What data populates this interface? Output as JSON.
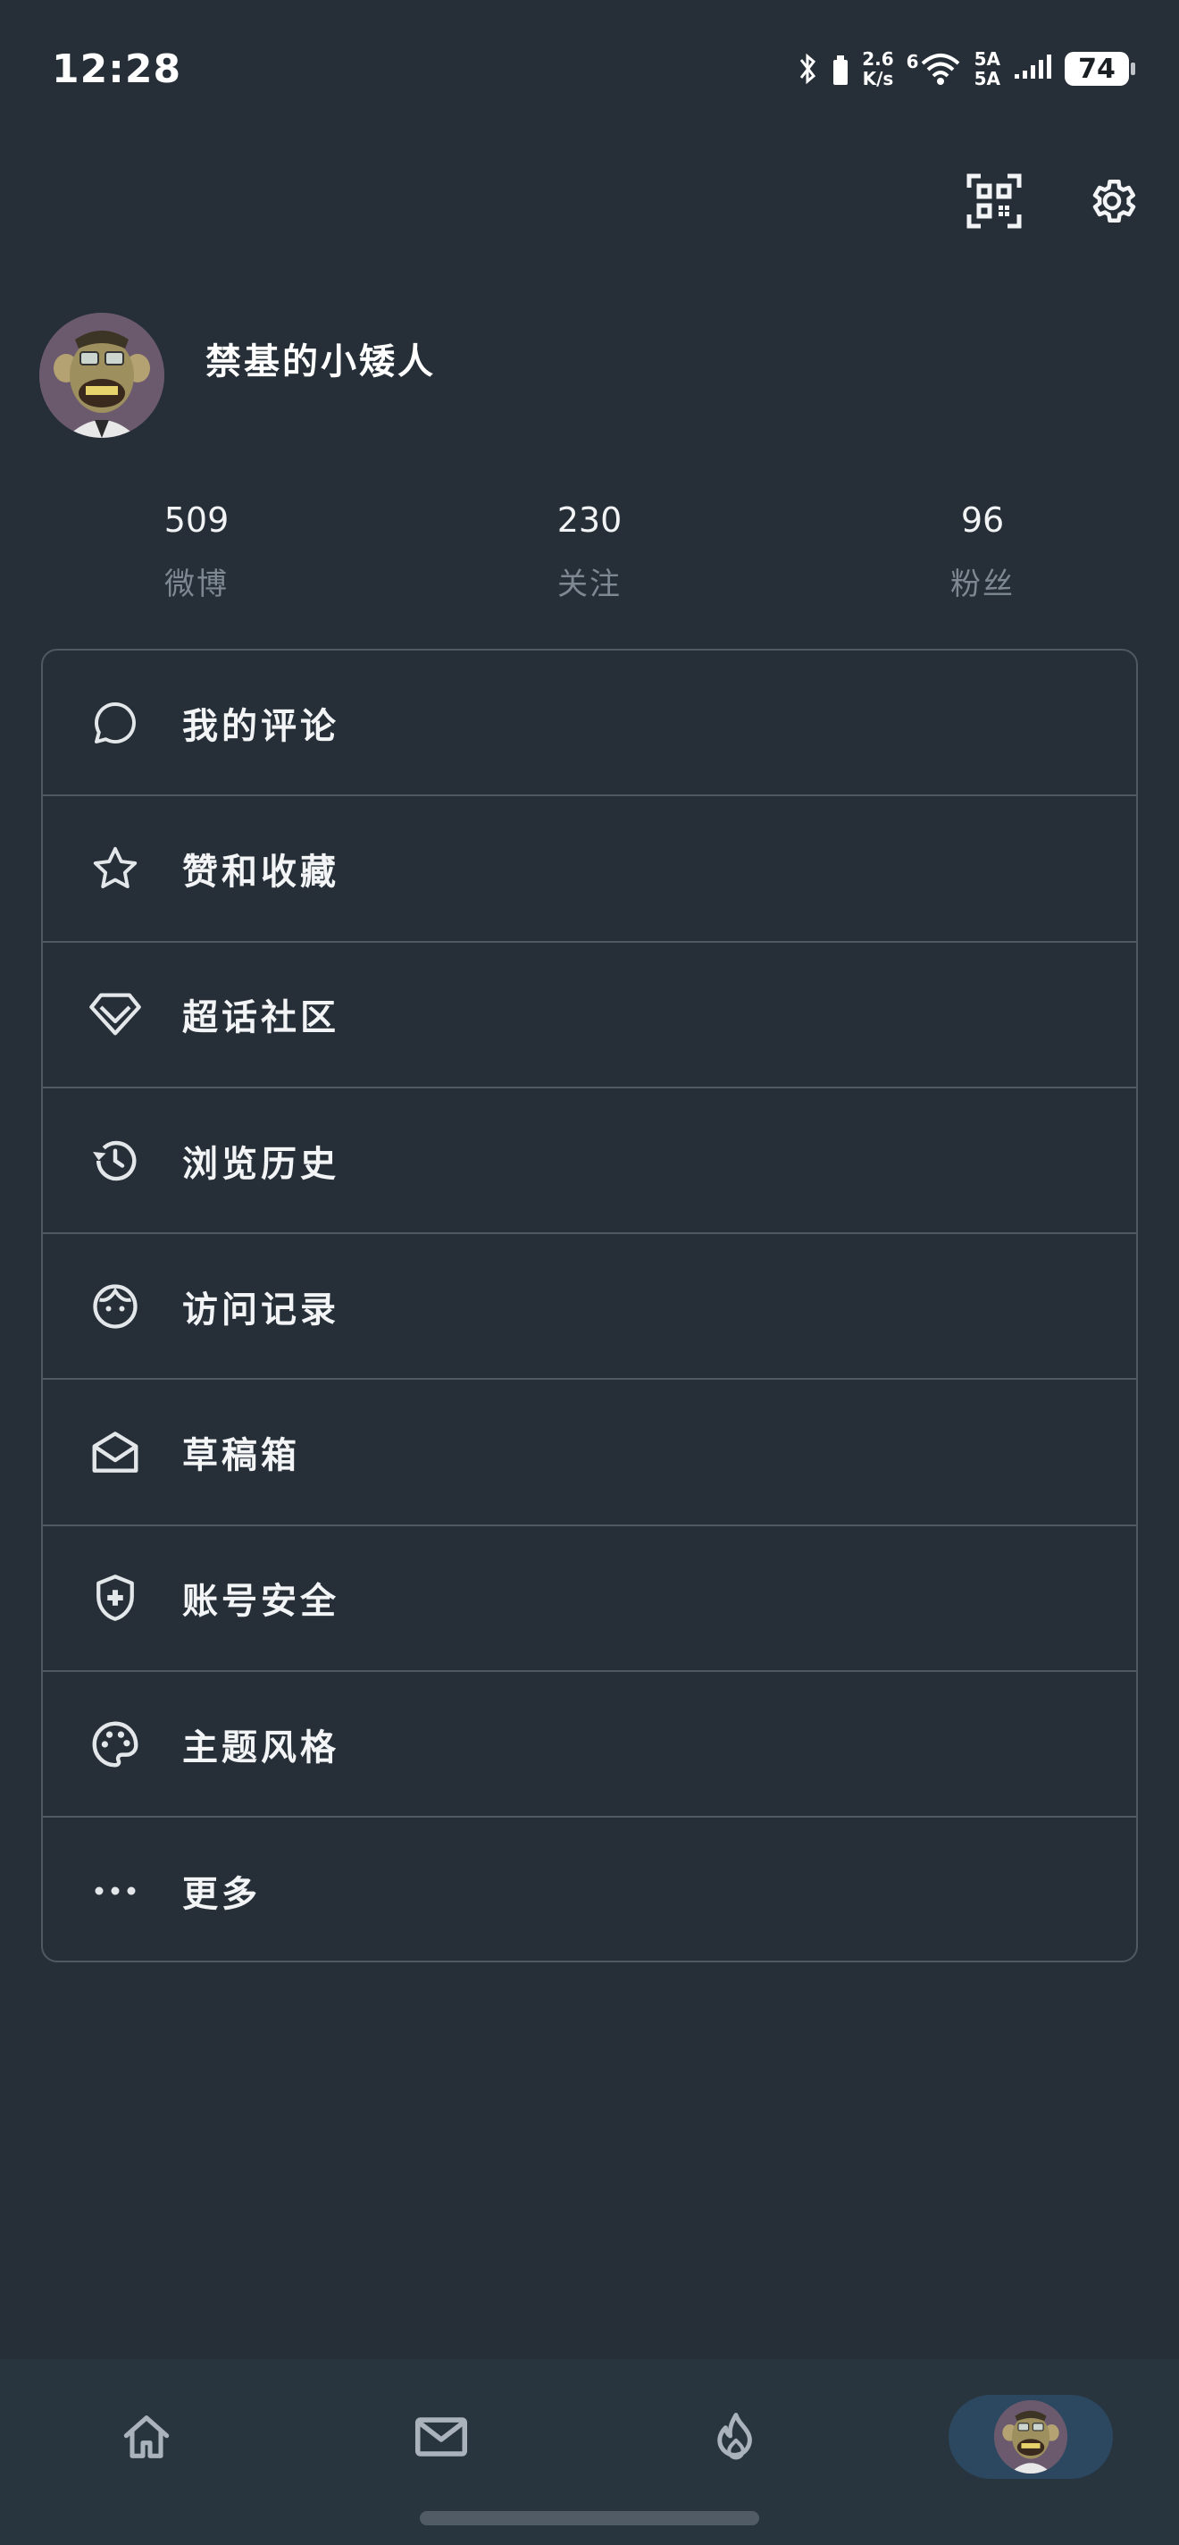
{
  "status_bar": {
    "time": "12:28",
    "net_speed_value": "2.6",
    "net_speed_unit": "K/s",
    "wifi_badge": "6",
    "signal_label_1": "5A",
    "signal_label_2": "5A",
    "battery": "74"
  },
  "top_actions": {
    "qr_icon": "qr-code-scan-icon",
    "settings_icon": "gear-icon"
  },
  "profile": {
    "username": "禁基的小矮人",
    "avatar": "ape-avatar"
  },
  "stats": [
    {
      "value": "509",
      "label": "微博"
    },
    {
      "value": "230",
      "label": "关注"
    },
    {
      "value": "96",
      "label": "粉丝"
    }
  ],
  "menu": [
    {
      "label": "我的评论",
      "icon": "comment-icon"
    },
    {
      "label": "赞和收藏",
      "icon": "star-icon"
    },
    {
      "label": "超话社区",
      "icon": "diamond-icon"
    },
    {
      "label": "浏览历史",
      "icon": "history-icon"
    },
    {
      "label": "访问记录",
      "icon": "face-icon"
    },
    {
      "label": "草稿箱",
      "icon": "drafts-mail-icon"
    },
    {
      "label": "账号安全",
      "icon": "shield-plus-icon"
    },
    {
      "label": "主题风格",
      "icon": "palette-icon"
    },
    {
      "label": "更多",
      "icon": "more-dots-icon"
    }
  ],
  "bottom_nav": [
    {
      "icon": "home-icon"
    },
    {
      "icon": "mail-icon"
    },
    {
      "icon": "fire-icon"
    },
    {
      "icon": "profile-avatar",
      "active": true
    }
  ],
  "colors": {
    "background": "#262f37",
    "divider": "#4f5963",
    "muted_text": "#7d8893",
    "nav_background": "#29353e",
    "active_pill": "#2c4760"
  }
}
